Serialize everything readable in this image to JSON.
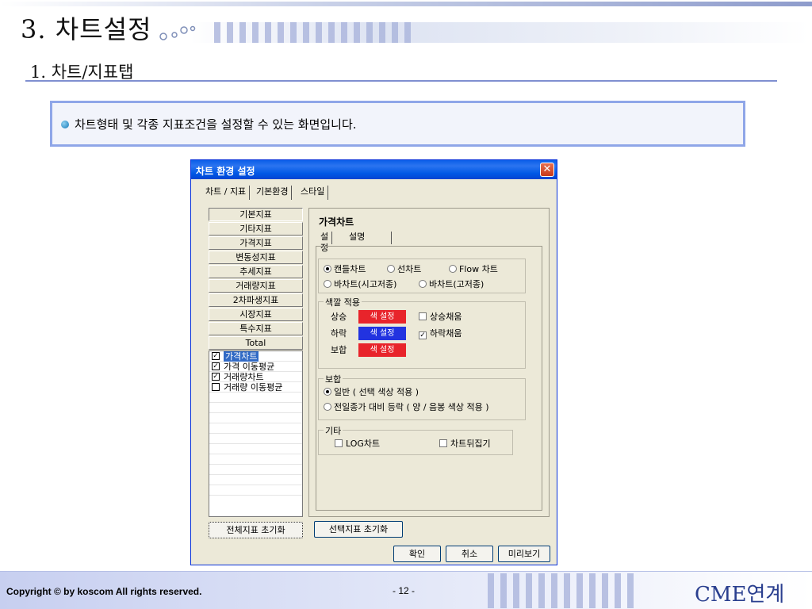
{
  "slide": {
    "title": "3. 차트설정",
    "subtitle": "1. 차트/지표탭",
    "info_text": "차트형태 및 각종 지표조건을 설정할 수 있는 화면입니다.",
    "footer_copyright": "Copyright © by koscom All rights reserved.",
    "footer_page": "- 12 -",
    "footer_brand": "CME연계"
  },
  "dialog": {
    "title": "차트 환경 설정",
    "close_glyph": "✕",
    "tabs": [
      "차트 / 지표",
      "기본환경",
      "스타일"
    ],
    "indicator_categories": [
      "기본지표",
      "기타지표",
      "가격지표",
      "변동성지표",
      "추세지표",
      "거래량지표",
      "2차파생지표",
      "시장지표",
      "특수지표",
      "Total"
    ],
    "indicator_checks": [
      {
        "label": "가격차트",
        "checked": true,
        "selected": true
      },
      {
        "label": "가격 이동평균",
        "checked": true,
        "selected": false
      },
      {
        "label": "거래량차트",
        "checked": true,
        "selected": false
      },
      {
        "label": "거래량 이동평균",
        "checked": false,
        "selected": false
      }
    ],
    "reset_all_button": "전체지표 초기화",
    "reset_selected_button": "선택지표 초기화",
    "panel_title": "가격차트",
    "sub_tabs": [
      "설정",
      "설명"
    ],
    "chart_types": {
      "candle": "캔들차트",
      "line": "선차트",
      "flow": "Flow 차트",
      "bar_hloc": "바차트(시고저종)",
      "bar_hlc": "바차트(고저종)",
      "selected": "캔들차트"
    },
    "color_group": {
      "label": "색깔 적용",
      "rise_label": "상승",
      "fall_label": "하락",
      "flat_label": "보합",
      "color_button": "색 설정",
      "rise_fill_label": "상승채움",
      "fall_fill_label": "하락채움",
      "rise_fill_checked": false,
      "fall_fill_checked": true,
      "rise_color": "#e8242b",
      "fall_color": "#2233e0",
      "flat_color": "#e8242b"
    },
    "flat_group": {
      "label": "보합",
      "option_normal": "일반 ( 선택 색상 적용 )",
      "option_prev": "전일종가 대비 등락 ( 양 / 음봉 색상 적용 )",
      "selected": "normal"
    },
    "etc_group": {
      "label": "기타",
      "log_chart": "LOG차트",
      "invert_chart": "차트뒤집기",
      "log_checked": false,
      "invert_checked": false
    },
    "ok_button": "확인",
    "cancel_button": "취소",
    "preview_button": "미리보기"
  }
}
